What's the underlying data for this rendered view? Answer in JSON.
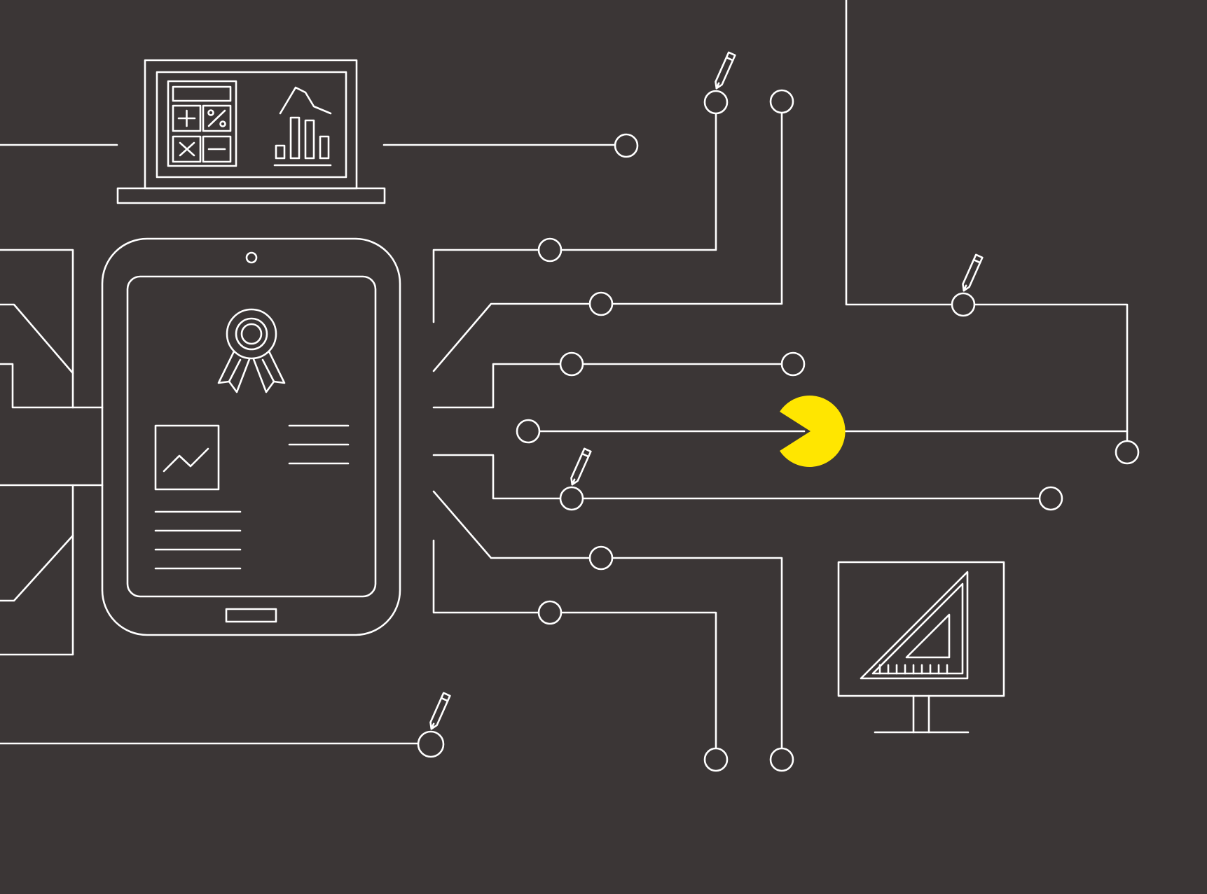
{
  "scene": {
    "background_color": "#3b3636",
    "line_color": "#ffffff",
    "accent_color": "#ffe600",
    "icons": {
      "laptop": "laptop-icon",
      "calculator": "calculator-icon",
      "bar_chart": "bar-chart-icon",
      "tablet": "tablet-icon",
      "award": "award-ribbon-icon",
      "line_chart": "line-chart-icon",
      "monitor": "monitor-icon",
      "set_square": "set-square-icon",
      "pencil": "pencil-icon",
      "pacman": "pacman-icon"
    }
  }
}
